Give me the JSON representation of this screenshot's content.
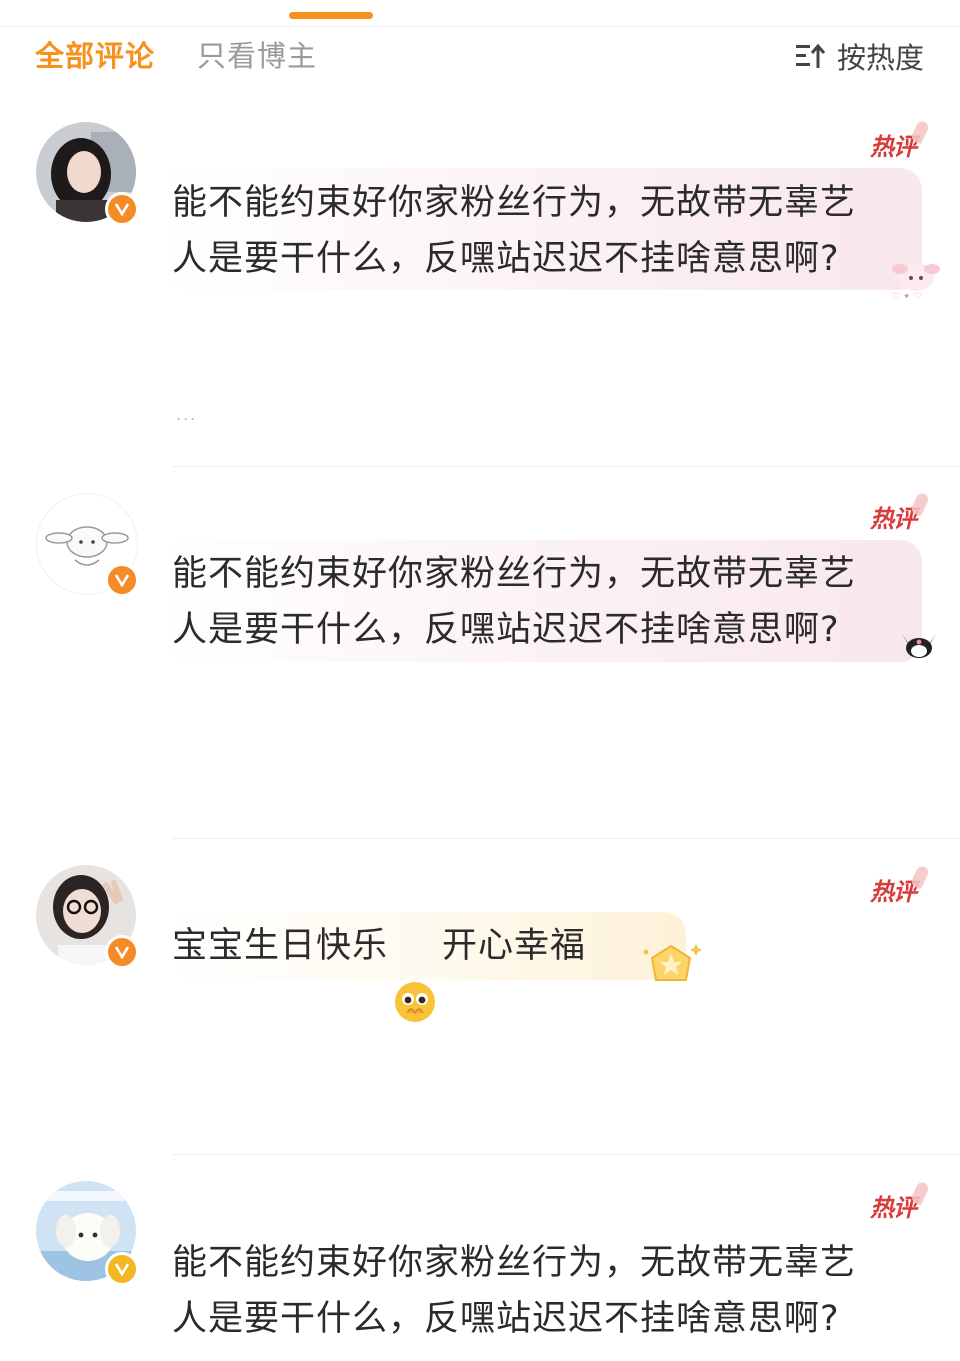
{
  "tabs": {
    "all_comments": "全部评论",
    "blogger_only": "只看博主",
    "sort_label": "按热度"
  },
  "accent_color": "#f7911e",
  "hot_badge_color": "#d93a3a",
  "more_indicator": "...",
  "comments": [
    {
      "hot_label": "热评",
      "text": "能不能约束好你家粉丝行为，无故带无辜艺\n人是要干什么，反嘿站迟迟不挂啥意思啊?",
      "avatar": "photo-avatar",
      "verified": "orange-v-badge"
    },
    {
      "hot_label": "热评",
      "text": "能不能约束好你家粉丝行为，无故带无辜艺\n人是要干什么，反嘿站迟迟不挂啥意思啊?",
      "avatar": "cartoon-dog-avatar",
      "verified": "orange-v-badge"
    },
    {
      "hot_label": "热评",
      "text_before": "宝宝生日快乐",
      "emoji": "pleading-face-emoji",
      "text_after": "开心幸福",
      "avatar": "photo-avatar-glasses",
      "verified": "orange-v-badge"
    },
    {
      "hot_label": "热评",
      "text": "能不能约束好你家粉丝行为，无故带无辜艺\n人是要干什么，反嘿站迟迟不挂啥意思啊?",
      "avatar": "plush-toy-avatar",
      "verified": "gold-v-badge"
    }
  ]
}
